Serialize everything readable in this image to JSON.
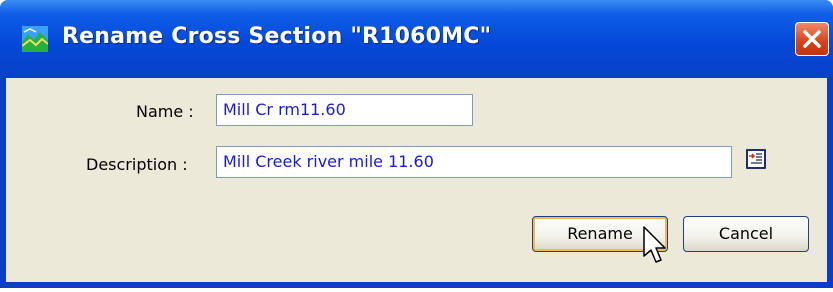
{
  "window": {
    "title": "Rename Cross Section \"R1060MC\"",
    "app_icon": "hec-ras-map-icon",
    "close_icon": "close-icon"
  },
  "form": {
    "name_label": "Name :",
    "name_value": "Mill Cr rm11.60",
    "description_label": "Description :",
    "description_value": "Mill Creek river mile 11.60",
    "description_browse_icon": "text-edit-icon"
  },
  "buttons": {
    "rename_label": "Rename",
    "cancel_label": "Cancel"
  },
  "colors": {
    "titlebar": "#0449d9",
    "dialog_bg": "#ece9d8",
    "field_text": "#1a1ad8",
    "default_button_highlight": "#f6b94c",
    "close_button": "#d6411a"
  }
}
